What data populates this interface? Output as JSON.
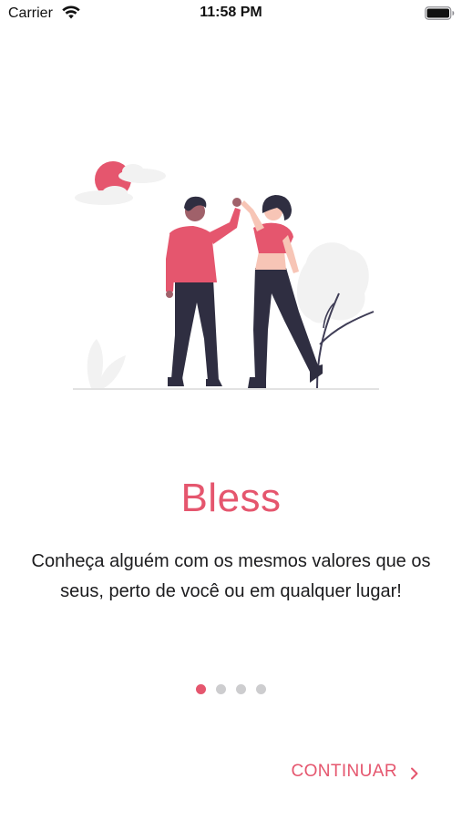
{
  "status_bar": {
    "carrier": "Carrier",
    "time": "11:58 PM",
    "wifi_icon": "wifi-icon",
    "battery_icon": "battery-full-icon"
  },
  "onboarding": {
    "title": "Bless",
    "subtitle": "Conheça alguém com os mesmos valores que os seus, perto de você ou em qualquer lugar!",
    "page_count": 4,
    "current_page": 1,
    "continue_label": "CONTINUAR",
    "continue_icon": "chevron-right-icon"
  },
  "colors": {
    "accent": "#e5566e",
    "dot_inactive": "#cdcdcf",
    "text": "#1c1c1e",
    "illustration_dark": "#2f2e41",
    "illustration_light": "#f2f2f2"
  }
}
